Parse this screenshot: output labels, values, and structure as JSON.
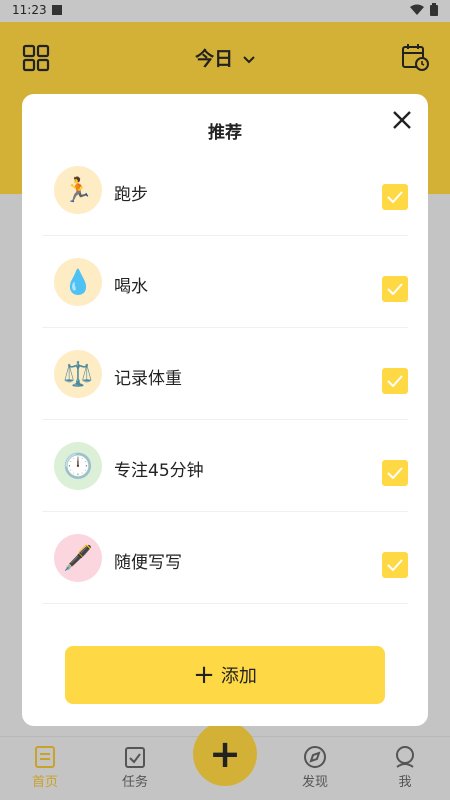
{
  "status": {
    "time": "11:23"
  },
  "header": {
    "title": "今日"
  },
  "modal": {
    "title": "推荐",
    "items": [
      {
        "label": "跑步",
        "icon": "🏃",
        "icon_name": "running-icon",
        "bg": "#fdecc4",
        "checked": true
      },
      {
        "label": "喝水",
        "icon": "💧",
        "icon_name": "water-drop-icon",
        "bg": "#fdecc4",
        "checked": true
      },
      {
        "label": "记录体重",
        "icon": "⚖️",
        "icon_name": "scale-icon",
        "bg": "#fdecc4",
        "checked": true
      },
      {
        "label": "专注45分钟",
        "icon": "🕛",
        "icon_name": "clock-icon",
        "bg": "#dcefd7",
        "checked": true
      },
      {
        "label": "随便写写",
        "icon": "🖋️",
        "icon_name": "pen-icon",
        "bg": "#fbd6df",
        "checked": true
      }
    ],
    "add_button": "添加"
  },
  "nav": {
    "items": [
      {
        "label": "首页",
        "active": true
      },
      {
        "label": "任务",
        "active": false
      },
      {
        "label": "发现",
        "active": false
      },
      {
        "label": "我",
        "active": false
      }
    ],
    "fab": "+"
  },
  "colors": {
    "accent": "#ffd945",
    "header": "#d3b137",
    "active_nav": "#c9a22a"
  }
}
